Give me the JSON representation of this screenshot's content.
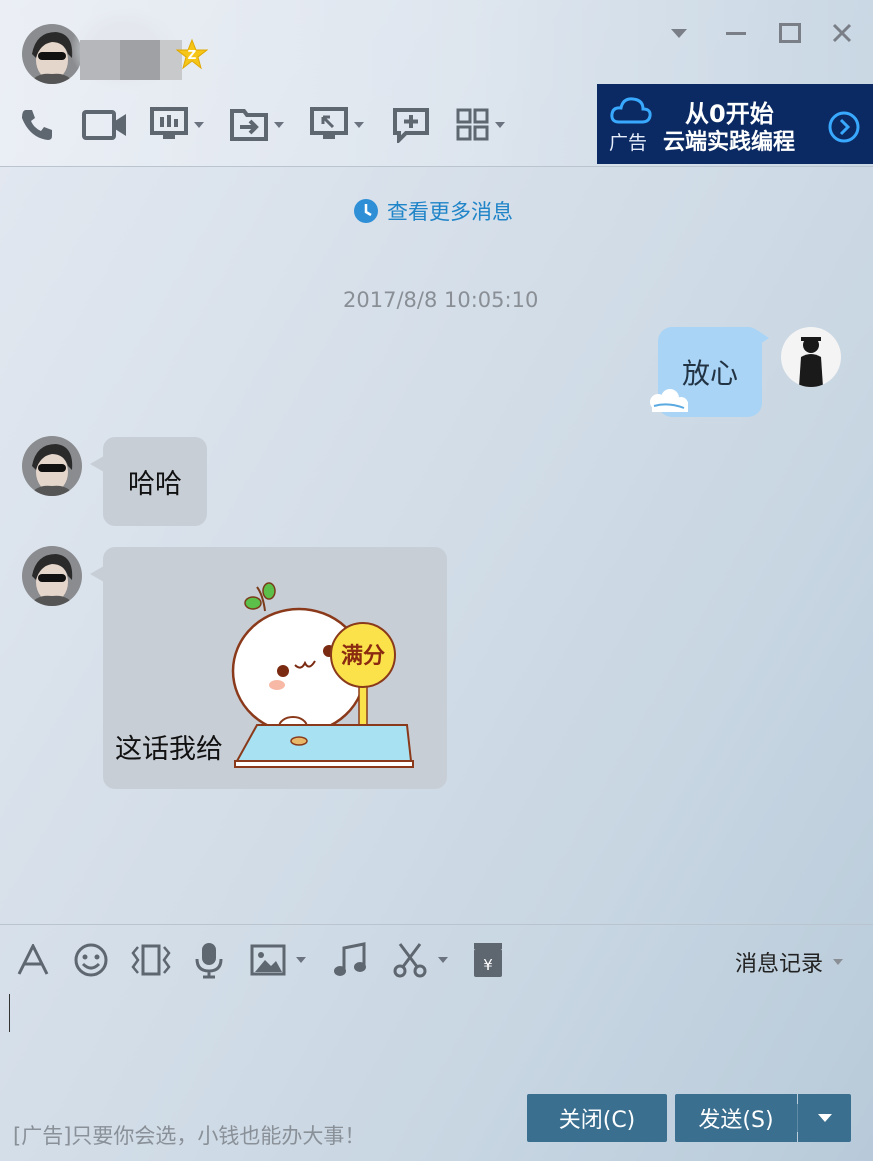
{
  "header": {
    "window_controls": [
      "dropdown",
      "minimize",
      "maximize",
      "close"
    ],
    "toolbar_icons": [
      "phone-icon",
      "video-icon",
      "screen-share-icon",
      "file-transfer-icon",
      "remote-desktop-icon",
      "add-chat-icon",
      "apps-icon"
    ],
    "ad": {
      "label": "广告",
      "line1": "从0开始",
      "line2": "云端实践编程"
    }
  },
  "chat": {
    "more_messages": "查看更多消息",
    "timestamp": "2017/8/8 10:05:10",
    "messages": [
      {
        "side": "me",
        "text": "放心"
      },
      {
        "side": "other",
        "text": "哈哈"
      },
      {
        "side": "other",
        "text": "这话我给",
        "sticker_text": "满分"
      }
    ]
  },
  "input": {
    "tool_icons": [
      "font-icon",
      "emoji-icon",
      "shake-icon",
      "voice-icon",
      "image-icon",
      "music-icon",
      "screenshot-icon",
      "red-packet-icon"
    ],
    "history_label": "消息记录",
    "ad_text": "[广告]只要你会选，小钱也能办大事！",
    "close_label": "关闭(C)",
    "send_label": "发送(S)"
  },
  "colors": {
    "accent": "#1f84c8",
    "button": "#3a6f8f",
    "ad_bg": "#0b2a63",
    "bubble_me": "#a9d4f5",
    "bubble_other": "#c8ced6"
  }
}
